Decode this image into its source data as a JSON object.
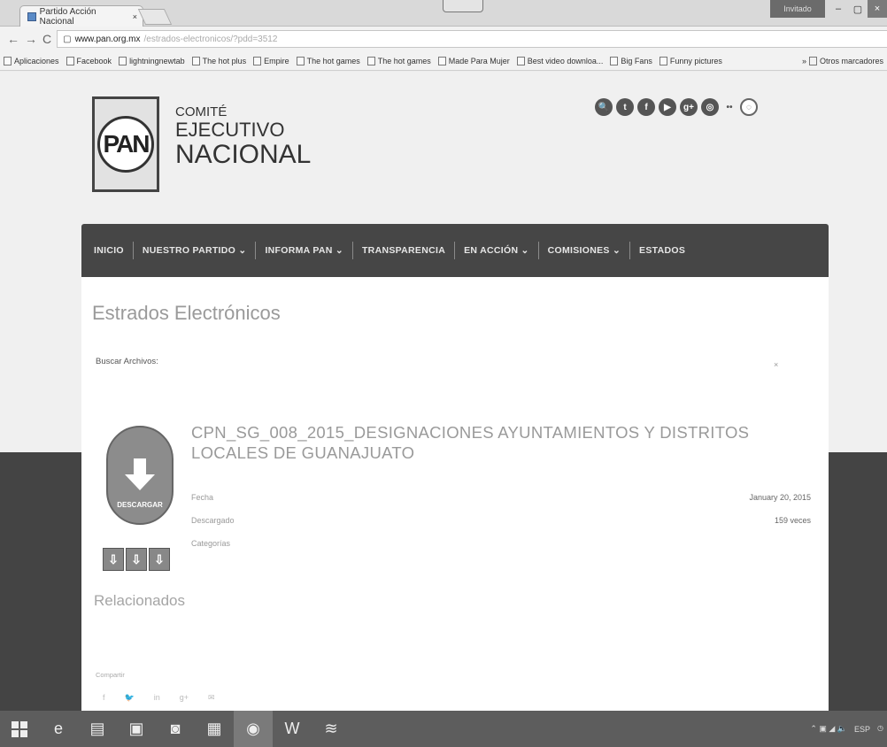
{
  "browser": {
    "tab_title": "Partido Acción Nacional",
    "tab_close": "×",
    "user_badge": "Invitado",
    "window_min": "–",
    "window_max": "▢",
    "window_close": "×",
    "address_domain": "www.pan.org.mx",
    "address_path": "/estrados-electronicos/?pdd=3512",
    "bookmarks": [
      "Aplicaciones",
      "Facebook",
      "lightningnewtab",
      "The hot plus",
      "Empire",
      "The hot games",
      "The hot games",
      "Made Para Mujer",
      "Best video downloa...",
      "Big Fans",
      "Funny pictures"
    ],
    "bookmarks_more": "Otros marcadores"
  },
  "site": {
    "logo_text": "PAN",
    "brand_line1": "COMITÉ",
    "brand_line2": "EJECUTIVO",
    "brand_line3": "NACIONAL",
    "social_icons": [
      "search-icon",
      "twitter-icon",
      "facebook-icon",
      "youtube-icon",
      "google-plus-icon",
      "instagram-icon",
      "flickr-icon",
      "vine-icon"
    ],
    "social_glyphs": [
      "🔍",
      "t",
      "f",
      "▶",
      "g+",
      "◎",
      "••",
      "◌"
    ],
    "nav": [
      "INICIO",
      "NUESTRO PARTIDO ⌄",
      "INFORMA PAN ⌄",
      "TRANSPARENCIA",
      "EN ACCIÓN ⌄",
      "COMISIONES ⌄",
      "ESTADOS"
    ]
  },
  "main": {
    "heading": "Estrados Electrónicos",
    "search_label": "Buscar Archivos:",
    "search_clear": "×",
    "doc_title": "CPN_SG_008_2015_DESIGNACIONES AYUNTAMIENTOS Y DISTRITOS LOCALES DE GUANAJUATO",
    "download_label": "DESCARGAR",
    "meta": [
      {
        "label": "Fecha",
        "value": "January 20, 2015"
      },
      {
        "label": "Descargado",
        "value": "159 veces"
      },
      {
        "label": "Categorías",
        "value": ""
      }
    ],
    "related_heading": "Relacionados",
    "share_label": "Compartir"
  },
  "taskbar": {
    "icons": [
      "windows-start-icon",
      "internet-explorer-icon",
      "file-explorer-icon",
      "app-icon",
      "media-icon",
      "store-icon",
      "chrome-icon",
      "word-icon",
      "spotify-icon"
    ],
    "glyphs": [
      "",
      "e",
      "▤",
      "▣",
      "◙",
      "▦",
      "◉",
      "W",
      "≋"
    ],
    "tray_lang": "ESP",
    "tray_icons": "⌃ ▣ ◢ 🔈"
  }
}
